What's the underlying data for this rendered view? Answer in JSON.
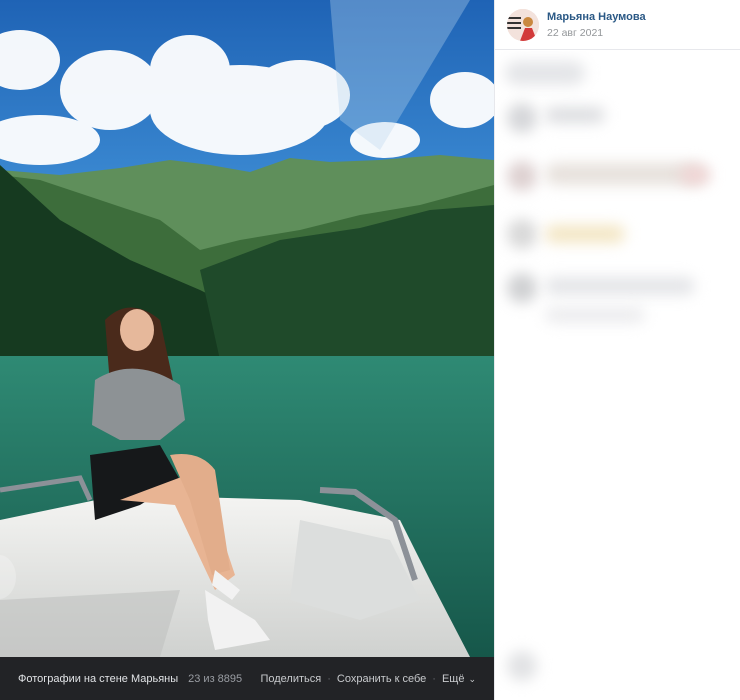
{
  "post": {
    "author_name": "Марьяна Наумова",
    "date": "22 авг 2021"
  },
  "viewer": {
    "album_title": "Фотографии на стене Марьяны",
    "counter": "23 из 8895",
    "share_label": "Поделиться",
    "save_label": "Сохранить к себе",
    "more_label": "Ещё",
    "separator": "·"
  },
  "colors": {
    "link_blue": "#2a5885",
    "bar_bg": "#222326",
    "lake": "#2f7f6c",
    "sky": "#2b79c9"
  },
  "icons": {
    "more_chevron": "chevron-down-icon",
    "prev_arrow": "arrow-left-icon"
  }
}
